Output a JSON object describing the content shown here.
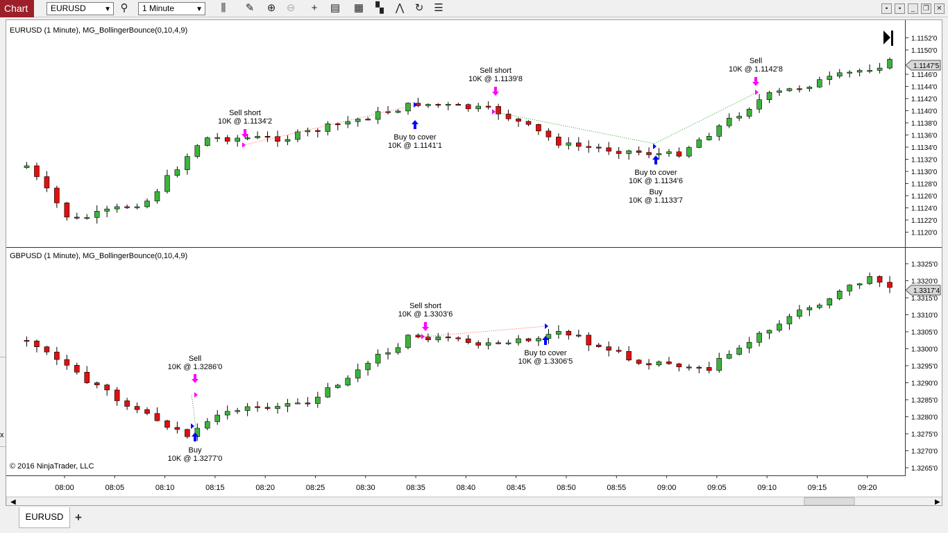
{
  "toolbar": {
    "chart_label": "Chart",
    "instrument": "EURUSD",
    "interval": "1 Minute",
    "icons": [
      "search-icon",
      "bar-type-icon",
      "pencil-icon",
      "zoom-in-icon",
      "zoom-out-icon",
      "crosshair-icon",
      "data-box-icon",
      "strategies-icon",
      "indicators-icon",
      "chart-trader-icon",
      "reload-icon",
      "properties-icon"
    ]
  },
  "window_buttons": [
    "tile-icon",
    "tile-icon-2",
    "minimize-icon",
    "restore-icon",
    "close-icon"
  ],
  "tabs": {
    "active": "EURUSD",
    "add": "+"
  },
  "side_stub": "x",
  "copyright": "© 2016 NinjaTrader, LLC",
  "time_labels": [
    "08:00",
    "08:05",
    "08:10",
    "08:15",
    "08:20",
    "08:25",
    "08:30",
    "08:35",
    "08:40",
    "08:45",
    "08:50",
    "08:55",
    "09:00",
    "09:05",
    "09:10",
    "09:15",
    "09:20"
  ],
  "colors": {
    "up": "#3cb43c",
    "down": "#e01010",
    "marker_sell": "#ff00ff",
    "marker_buy": "#0000ff",
    "line_red": "#ff4d4d",
    "line_green": "#2e9a2e"
  },
  "panels": [
    {
      "title": "EURUSD (1 Minute), MG_BollingerBounce(0,10,4,9)",
      "price_labels": [
        "1.1152'0",
        "1.1150'0",
        "1.1146'0",
        "1.1144'0",
        "1.1142'0",
        "1.1140'0",
        "1.1138'0",
        "1.1136'0",
        "1.1134'0",
        "1.1132'0",
        "1.1130'0",
        "1.1128'0",
        "1.1126'0",
        "1.1124'0",
        "1.1122'0",
        "1.1120'0"
      ],
      "current_price": "1.1147'5",
      "annotations": [
        {
          "line1": "Sell short",
          "line2": "10K @ 1.1134'2"
        },
        {
          "line1": "Buy to cover",
          "line2": "10K @ 1.1141'1"
        },
        {
          "line1": "Sell short",
          "line2": "10K @ 1.1139'8"
        },
        {
          "line1": "Buy to cover",
          "line2": "10K @ 1.1134'6"
        },
        {
          "line1": "Buy",
          "line2": "10K @ 1.1133'7"
        },
        {
          "line1": "Sell",
          "line2": "10K @ 1.1142'8"
        }
      ]
    },
    {
      "title": "GBPUSD (1 Minute), MG_BollingerBounce(0,10,4,9)",
      "price_labels": [
        "1.3325'0",
        "1.3320'0",
        "1.3315'0",
        "1.3310'0",
        "1.3305'0",
        "1.3300'0",
        "1.3295'0",
        "1.3290'0",
        "1.3285'0",
        "1.3280'0",
        "1.3275'0",
        "1.3270'0",
        "1.3265'0"
      ],
      "current_price": "1.3317'4",
      "annotations": [
        {
          "line1": "Sell",
          "line2": "10K @ 1.3286'0"
        },
        {
          "line1": "Buy",
          "line2": "10K @ 1.3277'0"
        },
        {
          "line1": "Sell short",
          "line2": "10K @ 1.3303'6"
        },
        {
          "line1": "Buy to cover",
          "line2": "10K @ 1.3306'5"
        }
      ]
    }
  ]
}
